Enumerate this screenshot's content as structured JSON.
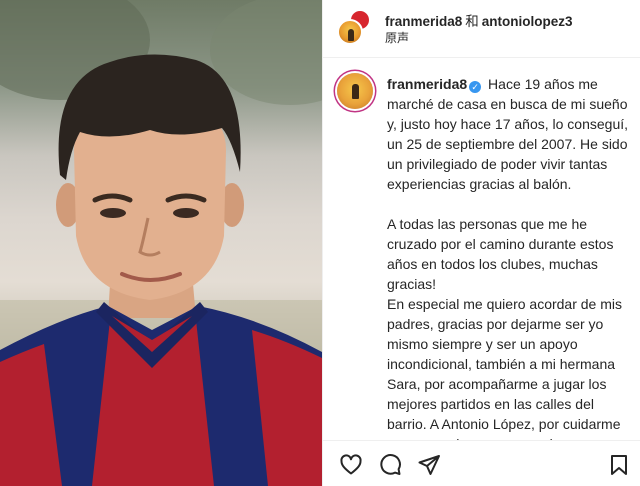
{
  "header": {
    "username": "franmerida8",
    "joiner": "和",
    "collaborator": "antoniolopez3",
    "subtitle": "原声"
  },
  "caption": {
    "username": "franmerida8",
    "paragraphs": [
      "Hace 19 años me marché de casa en busca de mi sueño y, justo hoy hace 17 años, lo conseguí, un 25 de septiembre del 2007. He sido un privilegiado de poder vivir tantas experiencias gracias al balón.",
      "A todas las personas que me he cruzado por el camino durante estos años en todos los clubes, muchas gracias!",
      "En especial me quiero acordar de mis padres, gracias por dejarme ser yo mismo siempre y ser un apoyo incondicional, también a mi hermana Sara, por acompañarme a jugar los mejores partidos en las calles del barrio. A Antonio López, por cuidarme como a un hermano, ser siempre honesto conmigo y"
    ]
  },
  "icons": {
    "like": "heart-icon",
    "comment": "comment-icon",
    "share": "send-icon",
    "save": "bookmark-icon",
    "verified": "verified-badge-icon"
  },
  "colors": {
    "verified": "#3897f0",
    "story_ring": "#c13584",
    "text": "#262626",
    "jersey_red": "#b3202f",
    "jersey_blue": "#1d2a6e"
  }
}
